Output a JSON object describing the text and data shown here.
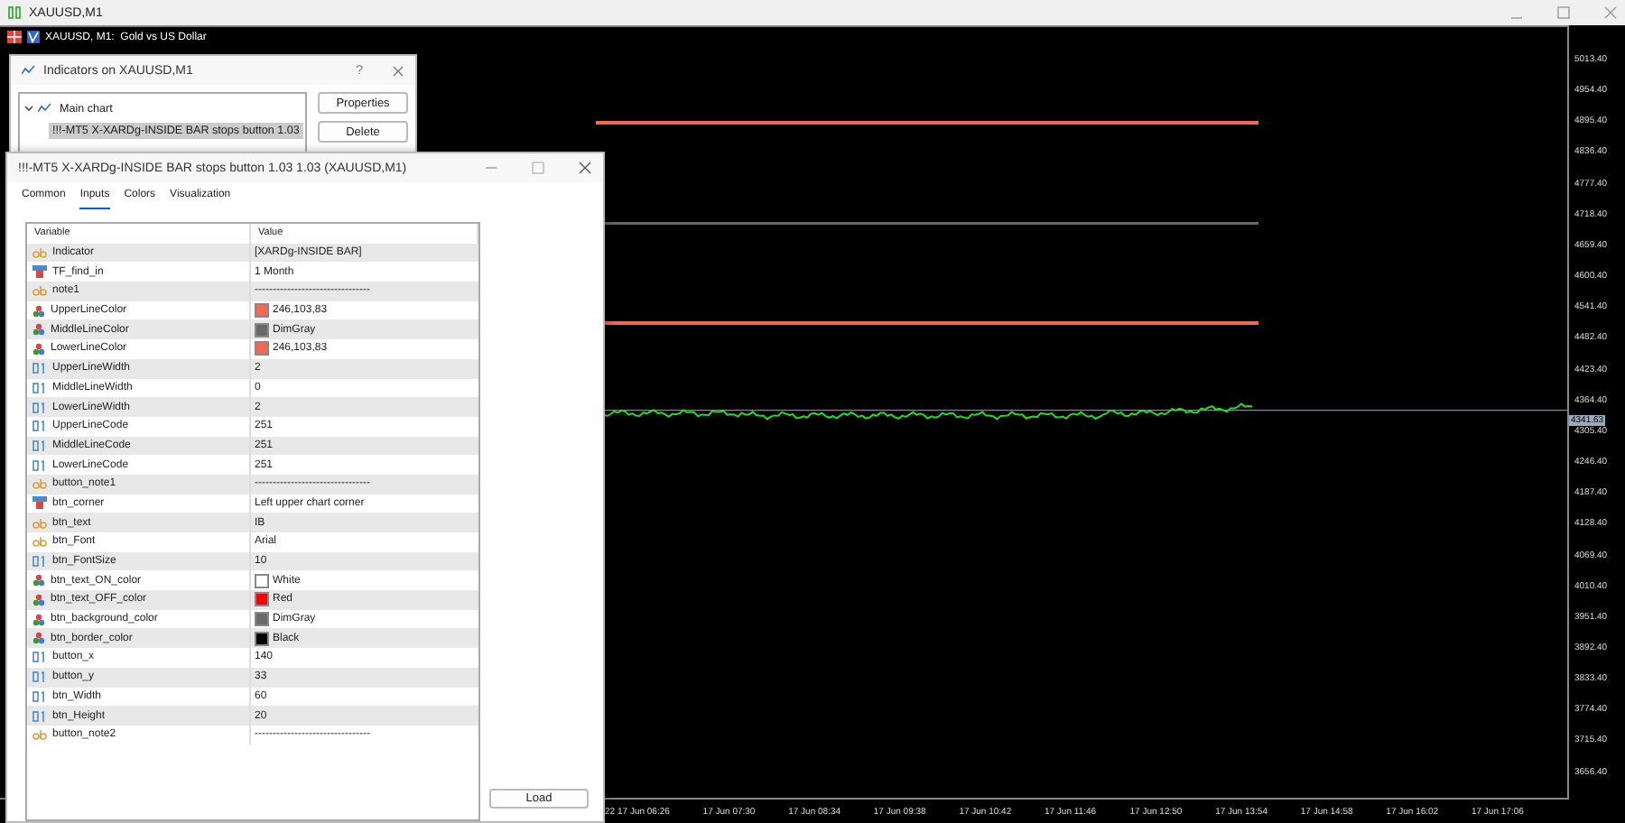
{
  "window": {
    "title": "XAUUSD,M1"
  },
  "chart": {
    "title": "XAUUSD, M1:  Gold vs US Dollar",
    "current_price": "4341.63",
    "price_ticks": [
      "5013.40",
      "4954.40",
      "4895.40",
      "4836.40",
      "4777.40",
      "4718.40",
      "4659.40",
      "4600.40",
      "4541.40",
      "4482.40",
      "4423.40",
      "4364.40",
      "4305.40",
      "4246.40",
      "4187.40",
      "4128.40",
      "4069.40",
      "4010.40",
      "3951.40",
      "3892.40",
      "3833.40",
      "3774.40",
      "3715.40",
      "3656.40"
    ],
    "time_ticks": [
      "22",
      "17 Jun 06:26",
      "17 Jun 07:30",
      "17 Jun 08:34",
      "17 Jun 09:38",
      "17 Jun 10:42",
      "17 Jun 11:46",
      "17 Jun 12:50",
      "17 Jun 13:54",
      "17 Jun 14:58",
      "17 Jun 16:02",
      "17 Jun 17:06"
    ]
  },
  "indicators_dialog": {
    "title": "Indicators on XAUUSD,M1",
    "help": "?",
    "tree": [
      {
        "label": "Main chart",
        "selected": false,
        "expanded": true,
        "children": [
          {
            "label": "!!!-MT5 X-XARDg-INSIDE BAR stops button 1.03",
            "selected": true
          }
        ]
      }
    ],
    "buttons": [
      "Properties",
      "Delete"
    ]
  },
  "properties_dialog": {
    "title": "!!!-MT5 X-XARDg-INSIDE BAR stops button 1.03 1.03 (XAUUSD,M1)",
    "tabs": [
      {
        "label": "Common",
        "selected": false
      },
      {
        "label": "Inputs",
        "selected": true
      },
      {
        "label": "Colors",
        "selected": false
      },
      {
        "label": "Visualization",
        "selected": false
      }
    ],
    "columns": [
      "Variable",
      "Value"
    ],
    "rows": [
      {
        "kind": "string",
        "variable": "Indicator",
        "value": "[XARDg-INSIDE BAR]"
      },
      {
        "kind": "enum",
        "variable": "TF_find_in",
        "value": "1 Month"
      },
      {
        "kind": "string",
        "variable": "note1",
        "value": "--------------------------------"
      },
      {
        "kind": "color",
        "variable": "UpperLineColor",
        "value": "246,103,83",
        "color": "#f66753"
      },
      {
        "kind": "color",
        "variable": "MiddleLineColor",
        "value": "DimGray",
        "color": "#696969"
      },
      {
        "kind": "color",
        "variable": "LowerLineColor",
        "value": "246,103,83",
        "color": "#f66753"
      },
      {
        "kind": "number",
        "variable": "UpperLineWidth",
        "value": "2"
      },
      {
        "kind": "number",
        "variable": "MiddleLineWidth",
        "value": "0"
      },
      {
        "kind": "number",
        "variable": "LowerLineWidth",
        "value": "2"
      },
      {
        "kind": "number",
        "variable": "UpperLineCode",
        "value": "251"
      },
      {
        "kind": "number",
        "variable": "MiddleLineCode",
        "value": "251"
      },
      {
        "kind": "number",
        "variable": "LowerLineCode",
        "value": "251"
      },
      {
        "kind": "string",
        "variable": "button_note1",
        "value": "--------------------------------"
      },
      {
        "kind": "enum",
        "variable": "btn_corner",
        "value": "Left upper chart corner"
      },
      {
        "kind": "string",
        "variable": "btn_text",
        "value": "IB"
      },
      {
        "kind": "string",
        "variable": "btn_Font",
        "value": "Arial"
      },
      {
        "kind": "number",
        "variable": "btn_FontSize",
        "value": "10"
      },
      {
        "kind": "color",
        "variable": "btn_text_ON_color",
        "value": "White",
        "color": "#ffffff"
      },
      {
        "kind": "color",
        "variable": "btn_text_OFF_color",
        "value": "Red",
        "color": "#ff0000"
      },
      {
        "kind": "color",
        "variable": "btn_background_color",
        "value": "DimGray",
        "color": "#696969"
      },
      {
        "kind": "color",
        "variable": "btn_border_color",
        "value": "Black",
        "color": "#000000"
      },
      {
        "kind": "number",
        "variable": "button_x",
        "value": "140"
      },
      {
        "kind": "number",
        "variable": "button_y",
        "value": "33"
      },
      {
        "kind": "number",
        "variable": "btn_Width",
        "value": "60"
      },
      {
        "kind": "number",
        "variable": "btn_Height",
        "value": "20"
      },
      {
        "kind": "string",
        "variable": "button_note2",
        "value": "--------------------------------"
      }
    ],
    "buttons": [
      "Load"
    ]
  }
}
